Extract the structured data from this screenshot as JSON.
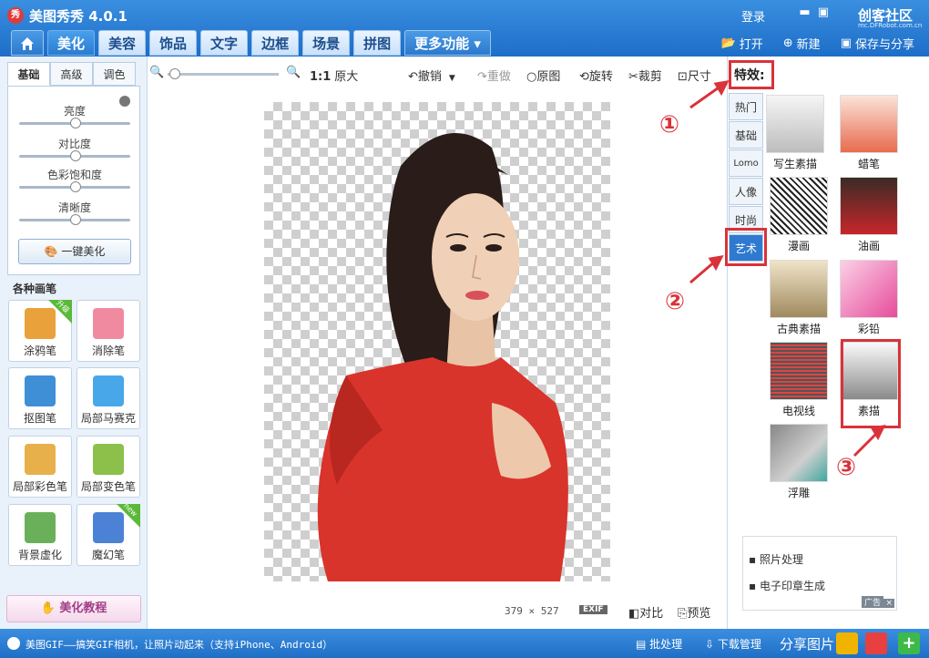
{
  "window": {
    "title": "美图秀秀 4.0.1",
    "logo_text": "秀",
    "login": "登录",
    "watermark": "创客社区",
    "watermark_sub": "mc.DFRobot.com.cn"
  },
  "tabs": [
    {
      "label": "美化",
      "active": true
    },
    {
      "label": "美容"
    },
    {
      "label": "饰品"
    },
    {
      "label": "文字"
    },
    {
      "label": "边框"
    },
    {
      "label": "场景"
    },
    {
      "label": "拼图"
    },
    {
      "label": "更多功能 ▾"
    }
  ],
  "top_actions": {
    "open": "打开",
    "new": "新建",
    "save_share": "保存与分享"
  },
  "left_panel": {
    "subtabs": [
      "基础",
      "高级",
      "调色"
    ],
    "sliders": [
      "亮度",
      "对比度",
      "色彩饱和度",
      "清晰度"
    ],
    "one_click": "一键美化",
    "brushes_header": "各种画笔",
    "brushes": [
      {
        "label": "涂鸦笔",
        "badge": "升级",
        "color": "#e9a23b"
      },
      {
        "label": "消除笔",
        "color": "#f08aa0"
      },
      {
        "label": "抠图笔",
        "color": "#3f8fd6"
      },
      {
        "label": "局部马赛克",
        "color": "#48a7e8"
      },
      {
        "label": "局部彩色笔",
        "color": "#e7b04a"
      },
      {
        "label": "局部变色笔",
        "color": "#8cc04a"
      },
      {
        "label": "背景虚化",
        "color": "#6ab05a"
      },
      {
        "label": "魔幻笔",
        "badge": "new",
        "color": "#4c82d6"
      }
    ],
    "tutorial": "美化教程"
  },
  "toolbar": {
    "zoom_one": "1:1",
    "original_size": "原大",
    "undo": "撤销",
    "redo": "重做",
    "original": "原图",
    "rotate": "旋转",
    "crop": "裁剪",
    "resize": "尺寸"
  },
  "status": {
    "dimensions": "379 × 527",
    "exif": "EXIF",
    "compare": "对比",
    "preview": "预览"
  },
  "right_panel": {
    "title": "特效:",
    "categories": [
      "热门",
      "基础",
      "Lomo",
      "人像",
      "时尚",
      "艺术"
    ],
    "active_category": "艺术",
    "effects": [
      "写生素描",
      "蜡笔",
      "漫画",
      "油画",
      "古典素描",
      "彩铅",
      "电视线",
      "素描",
      "浮雕"
    ],
    "ads": [
      "照片处理",
      "电子印章生成"
    ],
    "ad_tag": "广告",
    "ad_close": "×"
  },
  "annotations": [
    "①",
    "②",
    "③"
  ],
  "bottom_bar": {
    "message": "美图GIF——搞笑GIF相机，让照片动起来（支持iPhone、Android）",
    "batch": "批处理",
    "download": "下载管理",
    "share": "分享图片"
  },
  "colors": {
    "accent": "#2f7ad0",
    "annotation": "#d9323a",
    "dress": "#d8342c"
  }
}
